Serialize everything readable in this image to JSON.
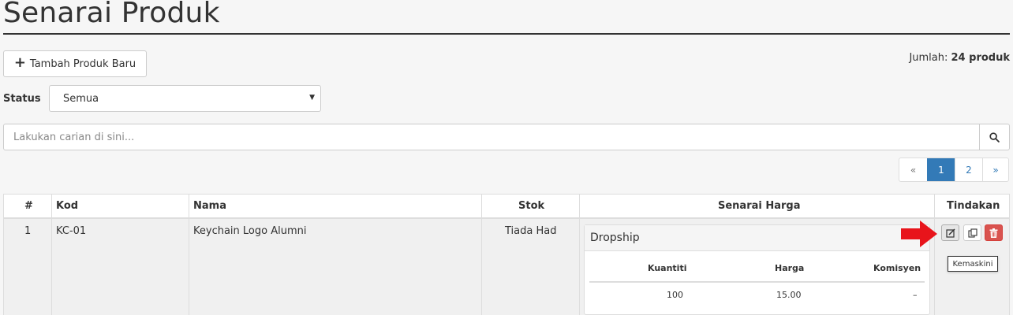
{
  "page": {
    "title": "Senarai Produk",
    "add_button_label": "Tambah Produk Baru",
    "count_label": "Jumlah:",
    "count_value": "24 produk"
  },
  "filter": {
    "status_label": "Status",
    "status_selected": "Semua"
  },
  "search": {
    "placeholder": "Lakukan carian di sini...",
    "icon": "search-icon"
  },
  "pagination": {
    "prev": "«",
    "pages": [
      "1",
      "2"
    ],
    "current": "1",
    "next": "»"
  },
  "table": {
    "headers": [
      "#",
      "Kod",
      "Nama",
      "Stok",
      "Senarai Harga",
      "Tindakan"
    ],
    "rows": [
      {
        "no": "1",
        "code": "KC-01",
        "name": "Keychain Logo Alumni",
        "stock": "Tiada Had",
        "price_list": {
          "title": "Dropship",
          "headers": [
            "Kuantiti",
            "Harga",
            "Komisyen"
          ],
          "rows": [
            [
              "100",
              "15.00",
              "–"
            ]
          ]
        }
      }
    ]
  },
  "actions": {
    "tooltip": "Kemaskini",
    "icons": [
      "edit-icon",
      "copy-icon",
      "trash-icon"
    ]
  },
  "colors": {
    "primary": "#337ab7",
    "danger": "#d9534f",
    "arrow": "#e8141b"
  }
}
